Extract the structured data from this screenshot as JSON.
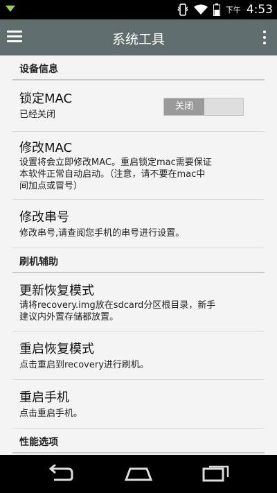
{
  "status_bar": {
    "ampm": "下午",
    "time": "4:53",
    "icons": [
      "notification-icon",
      "vibrate-icon",
      "wifi-icon",
      "battery-icon"
    ]
  },
  "app_bar": {
    "title": "系统工具",
    "icons": [
      "menu-icon",
      "overflow-menu-icon"
    ]
  },
  "sections": {
    "device_info": {
      "header": "设备信息",
      "lock_mac": {
        "title": "锁定MAC",
        "summary": "已经关闭",
        "toggle_label": "关闭",
        "toggle_on": false
      },
      "modify_mac": {
        "title": "修改MAC",
        "summary_lines": [
          "设置将会立即修改MAC。重启锁定mac需要保证",
          "本软件正常自动启动。（注意，请不要在mac中",
          "间加点或冒号）"
        ]
      },
      "modify_serial": {
        "title": "修改串号",
        "summary": "修改串号,请查阅您手机的串号进行设置。"
      }
    },
    "flash_assist": {
      "header": "刷机辅助",
      "update_recovery": {
        "title": "更新恢复模式",
        "summary_lines": [
          "请将recovery.img放在sdcard分区根目录，新手",
          "建议内外置存储都放置。"
        ]
      },
      "reboot_recovery": {
        "title": "重启恢复模式",
        "summary": "点击重启到recovery进行刷机。"
      },
      "reboot_phone": {
        "title": "重启手机",
        "summary": "点击重启手机。"
      }
    },
    "performance": {
      "header": "性能选项"
    }
  },
  "nav_bar": {
    "icons": [
      "back-icon",
      "home-icon",
      "recent-apps-icon"
    ]
  },
  "colors": {
    "app_bar": "#5f6e6c",
    "background": "#f4f4f4",
    "toggle_off": "#9a9a9a"
  }
}
